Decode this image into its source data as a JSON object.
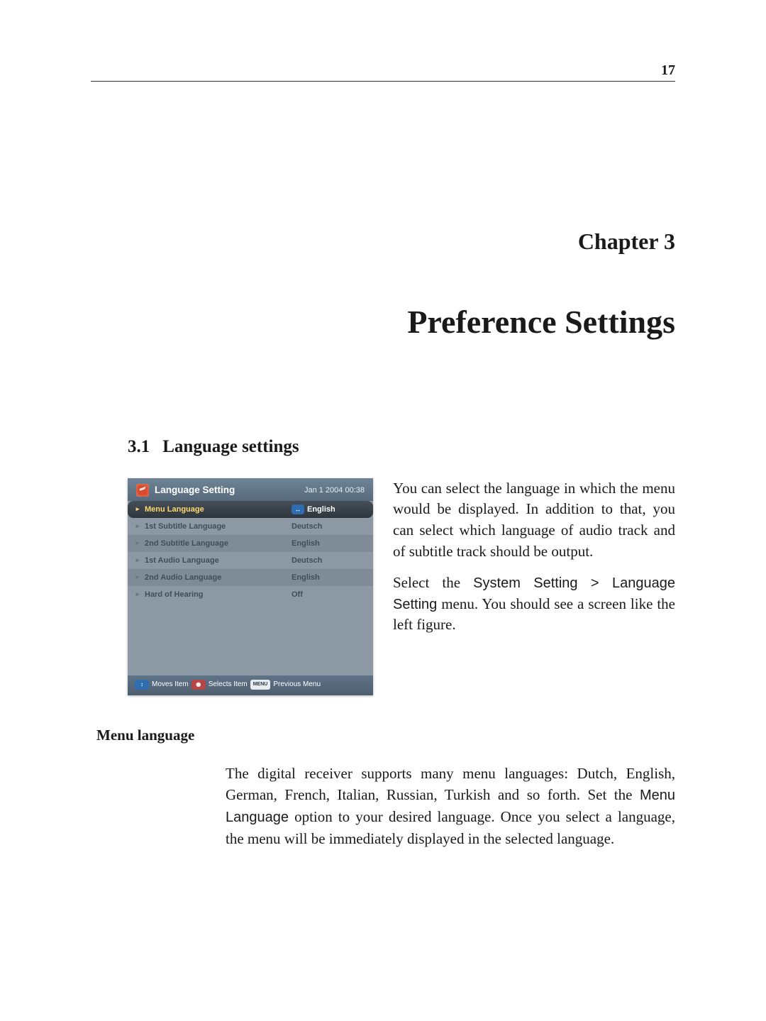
{
  "page": {
    "number": "17"
  },
  "chapter": {
    "label": "Chapter 3"
  },
  "title": "Preference Settings",
  "section": {
    "number": "3.1",
    "heading": "Language settings"
  },
  "intro": {
    "para1_text": "You can select the language in which the menu would be displayed. In addition to that, you can select which language of audio track and of subtitle track should be output.",
    "para2_prefix": "Select the ",
    "para2_menu_path": "System Setting > Language Setting",
    "para2_suffix": " menu. You should see a screen like the left figure."
  },
  "subhead": "Menu language",
  "body_para": {
    "prefix": "The digital receiver supports many menu languages: Dutch, English, German, French, Italian, Russian, Turkish and so forth. Set the ",
    "optref": "Menu Language",
    "suffix": " option to your desired language. Once you select a language, the menu will be immediately displayed in the selected language."
  },
  "ui": {
    "title": "Language Setting",
    "timestamp": "Jan 1 2004 00:38",
    "rows": [
      {
        "label": "Menu Language",
        "value": "English",
        "selected": true,
        "selectable": true
      },
      {
        "label": "1st Subtitle Language",
        "value": "Deutsch",
        "selected": false,
        "selectable": true
      },
      {
        "label": "2nd Subtitle Language",
        "value": "English",
        "selected": false,
        "selectable": true
      },
      {
        "label": "1st Audio Language",
        "value": "Deutsch",
        "selected": false,
        "selectable": true
      },
      {
        "label": "2nd Audio Language",
        "value": "English",
        "selected": false,
        "selectable": true
      },
      {
        "label": "Hard of Hearing",
        "value": "Off",
        "selected": false,
        "selectable": true
      }
    ],
    "footer": {
      "key_nav": "↕",
      "nav_text": "Moves Item",
      "key_sel": "◉",
      "sel_text": "Selects Item",
      "key_menu": "MENU",
      "menu_text": "Previous Menu"
    }
  }
}
